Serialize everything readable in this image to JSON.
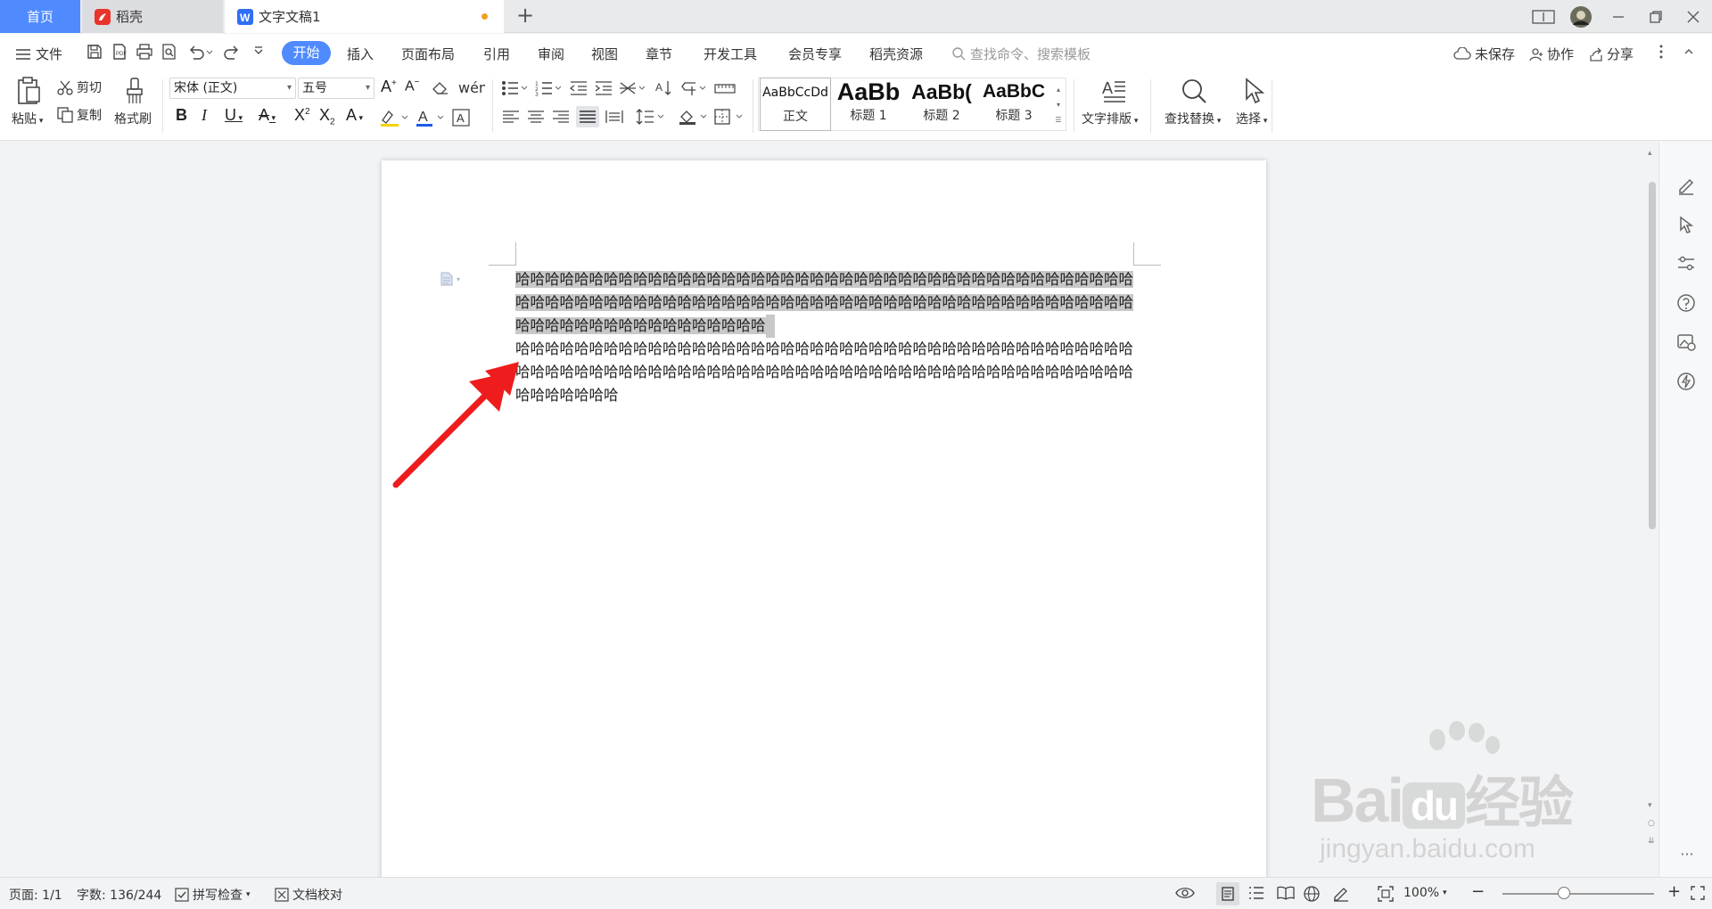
{
  "tabs": {
    "home": "首页",
    "daoke": "稻壳",
    "doc": "文字文稿1"
  },
  "menu": {
    "file": "文件",
    "items": [
      "开始",
      "插入",
      "页面布局",
      "引用",
      "审阅",
      "视图",
      "章节",
      "开发工具",
      "会员专享",
      "稻壳资源"
    ],
    "search_placeholder": "查找命令、搜索模板",
    "unsaved": "未保存",
    "collab": "协作",
    "share": "分享"
  },
  "ribbon": {
    "paste": "粘贴",
    "cut": "剪切",
    "copy": "复制",
    "format_painter": "格式刷",
    "font_name": "宋体 (正文)",
    "font_size": "五号",
    "styles": [
      {
        "sample": "AaBbCcDd",
        "name": "正文"
      },
      {
        "sample": "AaBb",
        "name": "标题 1"
      },
      {
        "sample": "AaBb(",
        "name": "标题 2"
      },
      {
        "sample": "AaBbC",
        "name": "标题 3"
      }
    ],
    "text_layout": "文字排版",
    "find_replace": "查找替换",
    "select": "选择"
  },
  "document": {
    "selected_text": "哈哈哈哈哈哈哈哈哈哈哈哈哈哈哈哈哈哈哈哈哈哈哈哈哈哈哈哈哈哈哈哈哈哈哈哈哈哈哈哈哈哈哈哈哈哈哈哈哈哈哈哈哈哈哈哈哈哈哈哈哈哈哈哈哈哈哈哈哈哈哈哈哈哈哈哈哈哈哈哈哈哈哈哈哈哈哈哈哈哈哈哈哈哈哈哈哈哈哈哈哈",
    "normal_text": "哈哈哈哈哈哈哈哈哈哈哈哈哈哈哈哈哈哈哈哈哈哈哈哈哈哈哈哈哈哈哈哈哈哈哈哈哈哈哈哈哈哈哈哈哈哈哈哈哈哈哈哈哈哈哈哈哈哈哈哈哈哈哈哈哈哈哈哈哈哈哈哈哈哈哈哈哈哈哈哈哈哈哈哈哈哈哈哈哈哈哈"
  },
  "status": {
    "page": "页面: 1/1",
    "words": "字数: 136/244",
    "spellcheck": "拼写检查",
    "doc_proof": "文档校对",
    "zoom": "100%"
  },
  "watermark": {
    "brand": "Bai",
    "brand2": "du",
    "cn": "经验",
    "url": "jingyan.baidu.com"
  },
  "colors": {
    "accent": "#4f8bff",
    "arrow": "#ee1c1c",
    "selection": "#c8c8c8",
    "unsaved_dot": "#f0a020"
  }
}
